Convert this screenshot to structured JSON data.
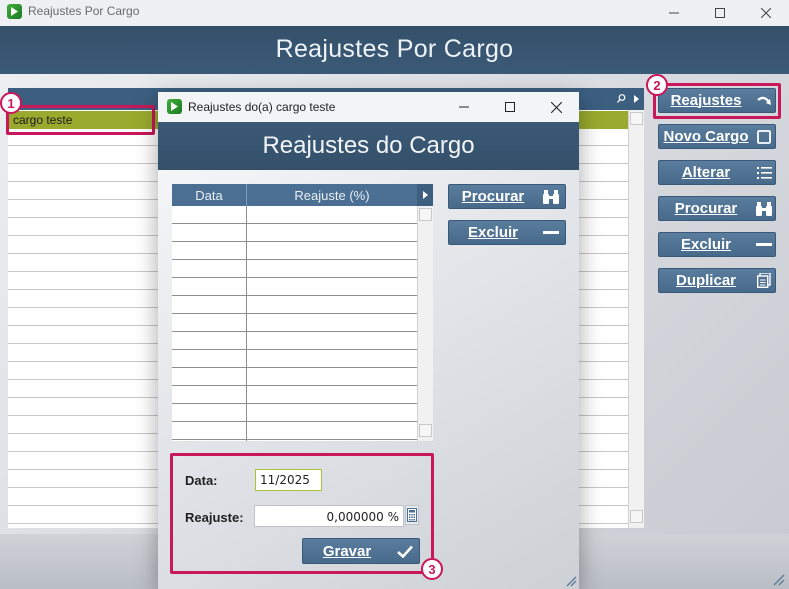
{
  "window": {
    "title": "Reajustes Por Cargo",
    "header_title": "Reajustes Por Cargo"
  },
  "grid": {
    "selected_row": "cargo teste"
  },
  "side_buttons": [
    {
      "label": "Reajustes",
      "icon": "redo-arrow-icon"
    },
    {
      "label": "Novo Cargo",
      "icon": "square-icon"
    },
    {
      "label": "Alterar",
      "icon": "list-icon"
    },
    {
      "label": "Procurar",
      "icon": "binoculars-icon"
    },
    {
      "label": "Excluir",
      "icon": "minus-icon"
    },
    {
      "label": "Duplicar",
      "icon": "copy-icon"
    }
  ],
  "dialog": {
    "title": "Reajustes do(a) cargo teste",
    "header_title": "Reajustes do Cargo",
    "table": {
      "columns": [
        "Data",
        "Reajuste (%)"
      ]
    },
    "buttons": {
      "procurar": "Procurar",
      "excluir": "Excluir",
      "gravar": "Gravar"
    },
    "form": {
      "data_label": "Data:",
      "data_value": "11/2025",
      "reajuste_label": "Reajuste:",
      "reajuste_value": "0,000000 %"
    }
  },
  "annotations": [
    "1",
    "2",
    "3"
  ],
  "colors": {
    "header": "#3b5a77",
    "button": "#4f7294",
    "selected_row": "#9aaa2e",
    "annotation": "#c8175a"
  }
}
